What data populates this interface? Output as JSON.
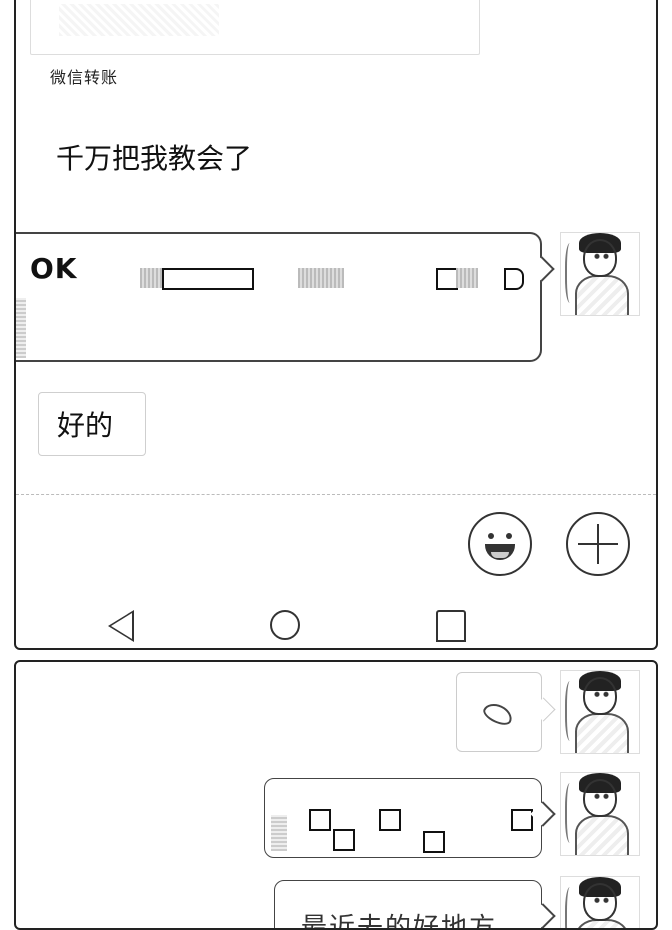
{
  "chat": {
    "transfer_label": "微信转账",
    "messages": [
      {
        "side": "left",
        "text": "千万把我教会了"
      },
      {
        "side": "right",
        "text": "OK"
      },
      {
        "side": "left",
        "text": "好的"
      }
    ]
  },
  "input_bar": {
    "emoji_icon": "smiley-face-icon",
    "plus_icon": "plus-icon"
  },
  "nav_bar": {
    "back_icon": "back-triangle-icon",
    "home_icon": "home-circle-icon",
    "recent_icon": "recent-square-icon"
  },
  "second_panel": {
    "sticker_icon": "sticker-icon",
    "partial_text": "最近去的好地方"
  }
}
